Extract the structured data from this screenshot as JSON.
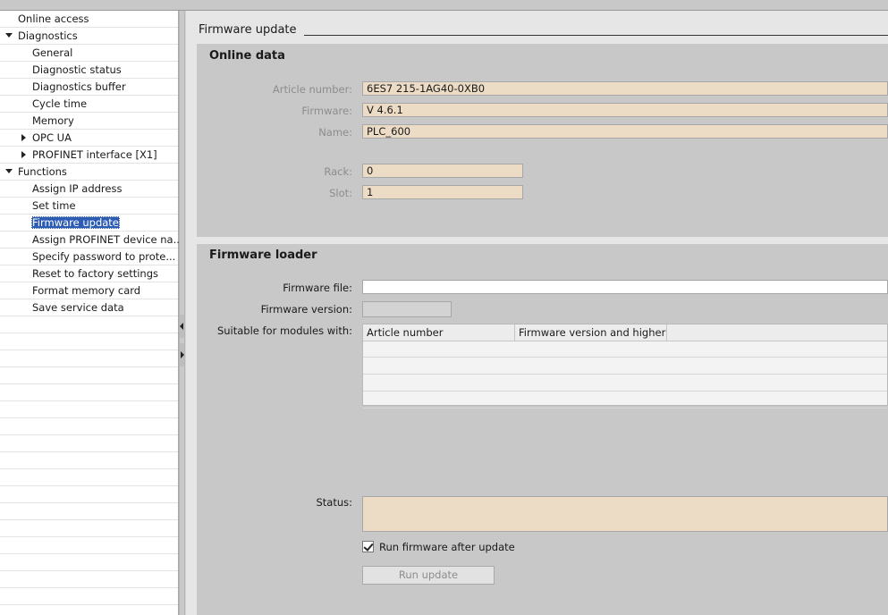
{
  "nav": {
    "items": [
      {
        "label": "Online access",
        "level": 0,
        "twisty": "none",
        "selected": false
      },
      {
        "label": "Diagnostics",
        "level": 0,
        "twisty": "down",
        "selected": false
      },
      {
        "label": "General",
        "level": 1,
        "twisty": "none",
        "selected": false
      },
      {
        "label": "Diagnostic status",
        "level": 1,
        "twisty": "none",
        "selected": false
      },
      {
        "label": "Diagnostics buffer",
        "level": 1,
        "twisty": "none",
        "selected": false
      },
      {
        "label": "Cycle time",
        "level": 1,
        "twisty": "none",
        "selected": false
      },
      {
        "label": "Memory",
        "level": 1,
        "twisty": "none",
        "selected": false
      },
      {
        "label": "OPC UA",
        "level": 1,
        "twisty": "right",
        "selected": false
      },
      {
        "label": "PROFINET interface [X1]",
        "level": 1,
        "twisty": "right",
        "selected": false
      },
      {
        "label": "Functions",
        "level": 0,
        "twisty": "down",
        "selected": false
      },
      {
        "label": "Assign IP address",
        "level": 1,
        "twisty": "none",
        "selected": false
      },
      {
        "label": "Set time",
        "level": 1,
        "twisty": "none",
        "selected": false
      },
      {
        "label": "Firmware update",
        "level": 1,
        "twisty": "none",
        "selected": true
      },
      {
        "label": "Assign PROFINET device na...",
        "level": 1,
        "twisty": "none",
        "selected": false
      },
      {
        "label": "Specify password to prote...",
        "level": 1,
        "twisty": "none",
        "selected": false
      },
      {
        "label": "Reset to factory settings",
        "level": 1,
        "twisty": "none",
        "selected": false
      },
      {
        "label": "Format memory card",
        "level": 1,
        "twisty": "none",
        "selected": false
      },
      {
        "label": "Save service data",
        "level": 1,
        "twisty": "none",
        "selected": false
      }
    ]
  },
  "page": {
    "title": "Firmware update"
  },
  "online_data": {
    "title": "Online data",
    "article_number": {
      "label": "Article number:",
      "value": "6ES7 215-1AG40-0XB0"
    },
    "firmware": {
      "label": "Firmware:",
      "value": "V 4.6.1"
    },
    "name": {
      "label": "Name:",
      "value": "PLC_600"
    },
    "rack": {
      "label": "Rack:",
      "value": "0"
    },
    "slot": {
      "label": "Slot:",
      "value": "1"
    }
  },
  "loader": {
    "title": "Firmware loader",
    "file": {
      "label": "Firmware file:",
      "value": ""
    },
    "version": {
      "label": "Firmware version:",
      "value": ""
    },
    "suitable": {
      "label": "Suitable for modules with:",
      "columns": [
        "Article number",
        "Firmware version and higher"
      ],
      "rows": []
    },
    "status": {
      "label": "Status:",
      "value": ""
    },
    "run_after": {
      "label": "Run firmware after update",
      "checked": true
    },
    "run_button": {
      "label": "Run update",
      "enabled": false
    }
  },
  "colors": {
    "selection": "#2b5bb3",
    "readonly_field": "#ecdcc6",
    "section_bg": "#c8c8c8",
    "panel_bg": "#e6e6e6"
  }
}
